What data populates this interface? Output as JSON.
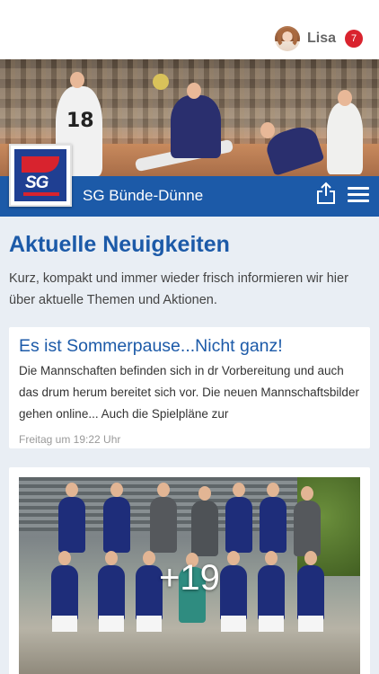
{
  "header": {
    "user_name": "Lisa",
    "notification_count": "7",
    "badge_color": "#d9232e"
  },
  "club": {
    "name": "SG Bünde-Dünne",
    "logo_text": "SG",
    "brand_color": "#1c5aa8"
  },
  "hero": {
    "jersey_number": "18"
  },
  "icons": {
    "share": "share-icon",
    "menu": "hamburger-menu-icon"
  },
  "news": {
    "title": "Aktuelle Neuigkeiten",
    "intro": "Kurz, kompakt und immer wieder frisch informieren wir hier über aktuelle Themen und Aktionen."
  },
  "articles": [
    {
      "title": "Es ist Sommerpause...Nicht ganz!",
      "text": "Die Mannschaften befinden sich in dr Vorbereitung und auch das drum herum bereitet sich vor. Die neuen Mannschaftsbilder gehen online... Auch die Spielpläne zur",
      "time": "Freitag um 19:22 Uhr"
    },
    {
      "photo_more_count": "+19"
    }
  ]
}
